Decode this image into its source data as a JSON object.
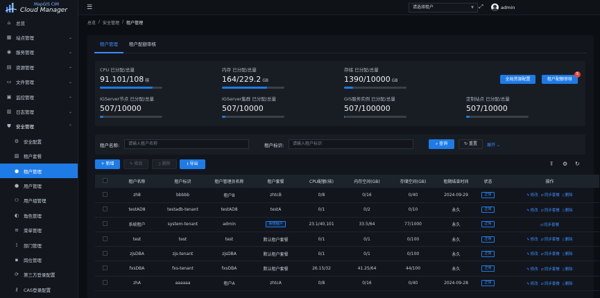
{
  "app": {
    "logo_sub": "MapGIS CIM",
    "logo_main": "Cloud Manager"
  },
  "sidebar": {
    "items": [
      {
        "label": "总览",
        "icon": "home-icon",
        "chevron": ""
      },
      {
        "label": "站点管理",
        "icon": "site-icon",
        "chevron": "⌄"
      },
      {
        "label": "服务管理",
        "icon": "service-icon",
        "chevron": "⌄"
      },
      {
        "label": "资源管理",
        "icon": "resource-icon",
        "chevron": "⌄"
      },
      {
        "label": "文件管理",
        "icon": "file-icon",
        "chevron": "⌄"
      },
      {
        "label": "监控管理",
        "icon": "monitor-icon",
        "chevron": "⌄"
      },
      {
        "label": "日志管理",
        "icon": "log-icon",
        "chevron": "⌄"
      },
      {
        "label": "安全管理",
        "icon": "shield-icon",
        "chevron": "⌃"
      }
    ],
    "sub_items": [
      {
        "label": "安全配置",
        "icon": "gear-icon"
      },
      {
        "label": "租户套餐",
        "icon": "package-icon"
      },
      {
        "label": "租户管理",
        "icon": "user-icon"
      },
      {
        "label": "用户管理",
        "icon": "user-icon"
      },
      {
        "label": "用户组管理",
        "icon": "users-icon"
      },
      {
        "label": "角色管理",
        "icon": "role-icon"
      },
      {
        "label": "菜单管理",
        "icon": "menu-icon"
      },
      {
        "label": "部门管理",
        "icon": "org-icon"
      },
      {
        "label": "岗位管理",
        "icon": "post-icon"
      },
      {
        "label": "第三方登录配置",
        "icon": "link-icon"
      },
      {
        "label": "CAS登录配置",
        "icon": "key-icon"
      }
    ]
  },
  "topbar": {
    "tenant_select": "请选择租户",
    "username": "admin"
  },
  "breadcrumb": [
    "总览",
    "安全管理",
    "租户管理"
  ],
  "tabs": [
    "租户管理",
    "租户配额审核"
  ],
  "quota": {
    "items": [
      {
        "label": "CPU 已分配/总量",
        "value": "91.101/108",
        "unit": "核",
        "fill": 0.84
      },
      {
        "label": "内存 已分配/总量",
        "value": "164/229.2",
        "unit": "GB",
        "fill": 0.72
      },
      {
        "label": "存储 已分配/总量",
        "value": "1390/10000",
        "unit": "GB",
        "fill": 0.14
      },
      {
        "label": "IGServer节点 已分配/总量",
        "value": "507/10000",
        "unit": "",
        "fill": 0.05
      },
      {
        "label": "IGServer集群 已分配/总量",
        "value": "507/10000",
        "unit": "",
        "fill": 0.05
      },
      {
        "label": "GIS服务实例 已分配/总量",
        "value": "507/100000",
        "unit": "",
        "fill": 0.01
      },
      {
        "label": "定制站点 已分配/总量",
        "value": "507/10000",
        "unit": "",
        "fill": 0.05
      }
    ],
    "btn_global": "全局资源配置",
    "btn_tenant": "租户配额审核",
    "badge": "5"
  },
  "search": {
    "name_label": "租户名称:",
    "name_placeholder": "请输入租户名称",
    "id_label": "租户标识:",
    "id_placeholder": "请输入租户标识",
    "query": "查询",
    "reset": "重置",
    "expand": "展开"
  },
  "toolbar": {
    "add": "新增",
    "edit": "修改",
    "delete": "删除",
    "export": "导出"
  },
  "table": {
    "headers": [
      "",
      "租户名称",
      "租户标识",
      "租户管理员名称",
      "租户套餐",
      "CPU配额(核)",
      "内存空间(GB)",
      "存储空间(GB)",
      "租期结束时间",
      "状态",
      "操作"
    ],
    "rows": [
      {
        "name": "zh8",
        "id": "bbbbb",
        "admin": "租户B",
        "pack": "zhtcB",
        "pack_tag": false,
        "cpu": "0/8",
        "mem": "0/16",
        "disk": "0/40",
        "end": "2024-09-29",
        "status": "正常",
        "actions": [
          "修改",
          "同步套餐",
          "删除"
        ]
      },
      {
        "name": "testAD8",
        "id": "testadb-tenant",
        "admin": "testAD8",
        "pack": "testA",
        "pack_tag": false,
        "cpu": "0/1",
        "mem": "0/2",
        "disk": "0/10",
        "end": "永久",
        "status": "正常",
        "actions": [
          "修改",
          "同步套餐",
          "删除"
        ]
      },
      {
        "name": "系统租户",
        "id": "system-tenant",
        "admin": "admin",
        "pack": "系统租户",
        "pack_tag": true,
        "cpu": "23.1/40.101",
        "mem": "33.5/64",
        "disk": "77/1000",
        "end": "永久",
        "status": "正常",
        "actions": [
          "同步套餐"
        ]
      },
      {
        "name": "test",
        "id": "test",
        "admin": "test",
        "pack": "默认租户套餐",
        "pack_tag": false,
        "cpu": "0/1",
        "mem": "0/1",
        "disk": "0/100",
        "end": "永久",
        "status": "正常",
        "actions": [
          "修改",
          "同步套餐",
          "删除"
        ]
      },
      {
        "name": "zjsDBA",
        "id": "zjs-tenant",
        "admin": "zjsDBA",
        "pack": "默认租户套餐",
        "pack_tag": false,
        "cpu": "0/1",
        "mem": "0/1",
        "disk": "0/100",
        "end": "永久",
        "status": "正常",
        "actions": [
          "修改",
          "同步套餐",
          "删除"
        ]
      },
      {
        "name": "fxsDBA",
        "id": "fxs-tenant",
        "admin": "fxsDBA",
        "pack": "默认租户套餐",
        "pack_tag": false,
        "cpu": "26.15/32",
        "mem": "41.25/64",
        "disk": "44/100",
        "end": "永久",
        "status": "正常",
        "actions": [
          "修改",
          "同步套餐",
          "删除"
        ]
      },
      {
        "name": "zhA",
        "id": "aaaaaa",
        "admin": "租户A",
        "pack": "zhtcA",
        "pack_tag": false,
        "cpu": "0/8",
        "mem": "0/16",
        "disk": "0/40",
        "end": "2024-09-28",
        "status": "正常",
        "actions": [
          "修改",
          "同步套餐",
          "删除"
        ]
      }
    ]
  },
  "colors": {
    "accent": "#1e7be6",
    "badge": "#e6453a",
    "bg": "#0b0e13"
  }
}
